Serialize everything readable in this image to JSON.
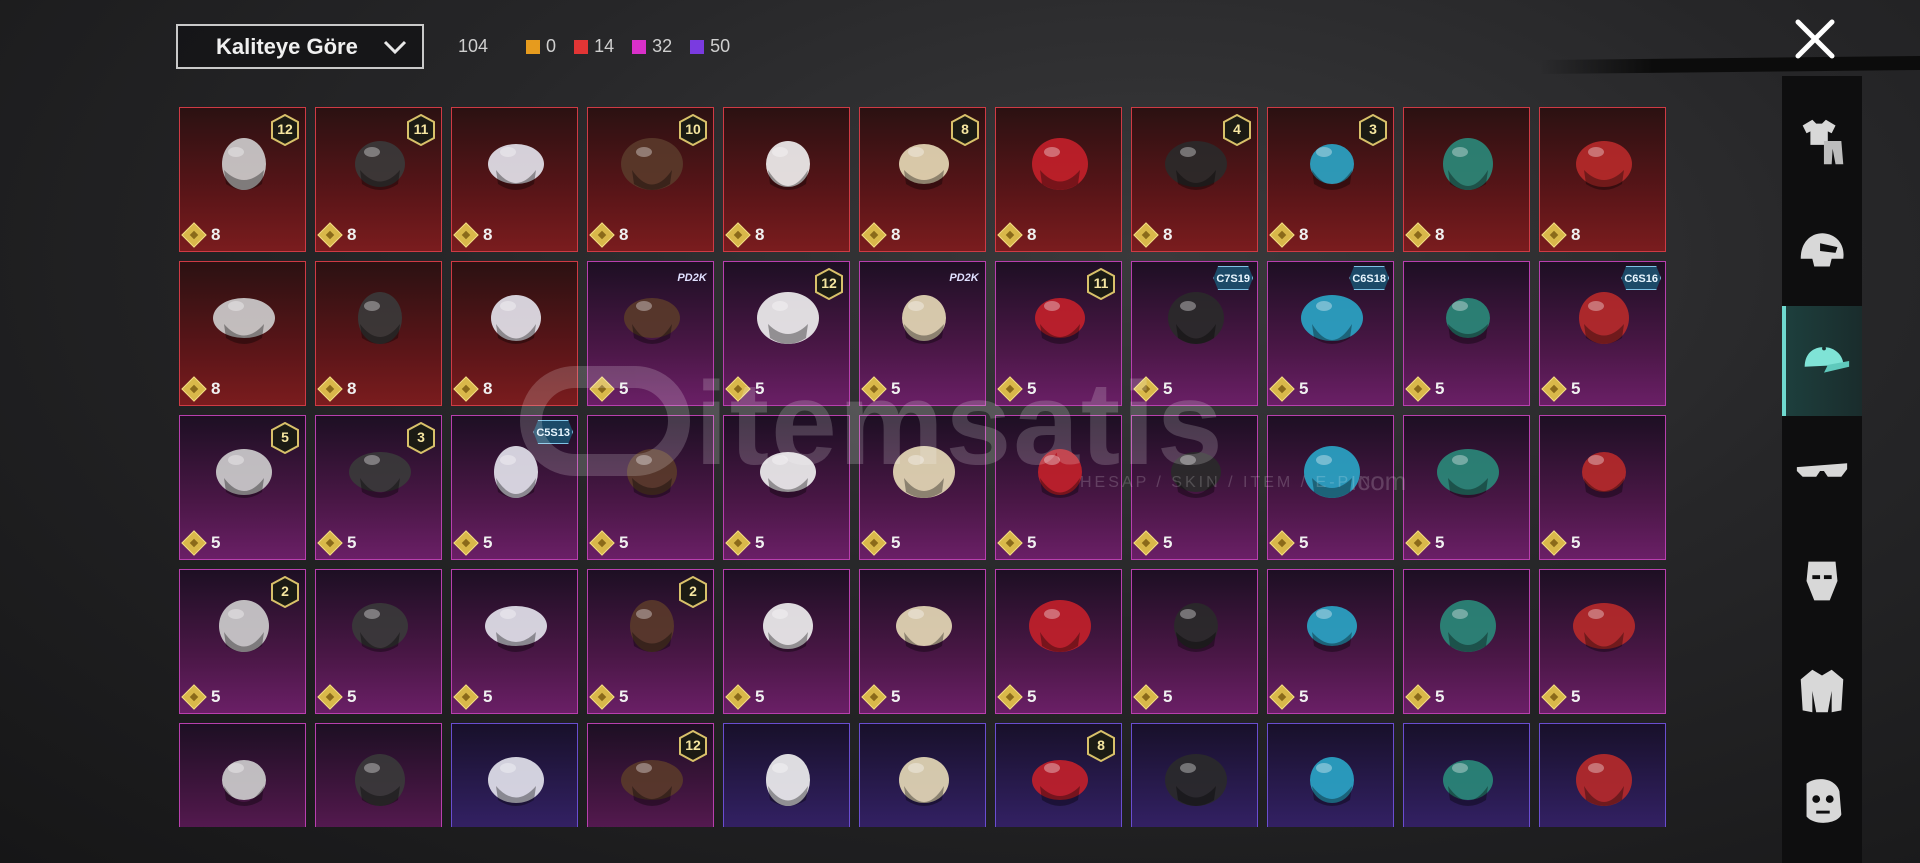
{
  "sort": {
    "label": "Kaliteye Göre"
  },
  "counts": {
    "total": "104",
    "tiers": [
      {
        "color": "#e69b1e",
        "value": "0"
      },
      {
        "color": "#e23535",
        "value": "14"
      },
      {
        "color": "#d930c9",
        "value": "32"
      },
      {
        "color": "#7a3be0",
        "value": "50"
      }
    ]
  },
  "watermark": {
    "brand": "itemsatis",
    "sub": "HESAP / SKIN / ITEM / E-PIN",
    "domain": ".com"
  },
  "sidebar": [
    {
      "name": "outfit-icon",
      "active": false
    },
    {
      "name": "helmet-icon",
      "active": false
    },
    {
      "name": "cap-icon",
      "active": true
    },
    {
      "name": "glasses-icon",
      "active": false
    },
    {
      "name": "mask-icon",
      "active": false
    },
    {
      "name": "jacket-icon",
      "active": false
    },
    {
      "name": "face-icon",
      "active": false
    }
  ],
  "items": [
    {
      "rarity": "red",
      "badge": "12",
      "tag": "",
      "value": "8",
      "icon": "silver-hair-bow-icon"
    },
    {
      "rarity": "red",
      "badge": "11",
      "tag": "",
      "value": "8",
      "icon": "black-ponytail-icon"
    },
    {
      "rarity": "red",
      "badge": "",
      "tag": "",
      "value": "8",
      "icon": "white-long-hair-icon"
    },
    {
      "rarity": "red",
      "badge": "10",
      "tag": "",
      "value": "8",
      "icon": "brown-braids-icon"
    },
    {
      "rarity": "red",
      "badge": "",
      "tag": "",
      "value": "8",
      "icon": "white-cowboy-hat-icon"
    },
    {
      "rarity": "red",
      "badge": "8",
      "tag": "",
      "value": "8",
      "icon": "blonde-elf-hair-icon"
    },
    {
      "rarity": "red",
      "badge": "",
      "tag": "",
      "value": "8",
      "icon": "red-helmet-icon"
    },
    {
      "rarity": "red",
      "badge": "4",
      "tag": "",
      "value": "8",
      "icon": "snowman-top-hat-icon"
    },
    {
      "rarity": "red",
      "badge": "3",
      "tag": "",
      "value": "8",
      "icon": "blue-curly-hair-icon"
    },
    {
      "rarity": "red",
      "badge": "",
      "tag": "",
      "value": "8",
      "icon": "dragon-helm-icon"
    },
    {
      "rarity": "red",
      "badge": "",
      "tag": "",
      "value": "8",
      "icon": "fox-mask-icon"
    },
    {
      "rarity": "red",
      "badge": "",
      "tag": "",
      "value": "8",
      "icon": "cyber-helmet-icon"
    },
    {
      "rarity": "red",
      "badge": "",
      "tag": "",
      "value": "8",
      "icon": "black-bunny-helmet-icon"
    },
    {
      "rarity": "red",
      "badge": "",
      "tag": "",
      "value": "8",
      "icon": "skull-helmet-icon"
    },
    {
      "rarity": "purple",
      "badge": "",
      "tag": "PD2K",
      "value": "5",
      "icon": "spiked-cap-icon"
    },
    {
      "rarity": "purple",
      "badge": "12",
      "tag": "",
      "value": "5",
      "icon": "orange-hair-icon"
    },
    {
      "rarity": "purple",
      "badge": "",
      "tag": "PD2K",
      "value": "5",
      "icon": "panda-head-icon"
    },
    {
      "rarity": "purple",
      "badge": "11",
      "tag": "",
      "value": "5",
      "icon": "flower-veil-icon"
    },
    {
      "rarity": "purple",
      "badge": "",
      "tag": "C7S19",
      "value": "5",
      "icon": "feather-headdress-icon"
    },
    {
      "rarity": "purple",
      "badge": "",
      "tag": "C6S18",
      "value": "5",
      "icon": "brown-hair-icon"
    },
    {
      "rarity": "purple",
      "badge": "",
      "tag": "",
      "value": "5",
      "icon": "red-bow-hair-icon"
    },
    {
      "rarity": "purple",
      "badge": "",
      "tag": "C6S16",
      "value": "5",
      "icon": "red-hood-icon"
    },
    {
      "rarity": "purple",
      "badge": "5",
      "tag": "",
      "value": "5",
      "icon": "pigtail-hair-icon"
    },
    {
      "rarity": "purple",
      "badge": "3",
      "tag": "",
      "value": "5",
      "icon": "jester-hat-icon"
    },
    {
      "rarity": "purple",
      "badge": "",
      "tag": "C5S13",
      "value": "5",
      "icon": "green-cat-hat-icon"
    },
    {
      "rarity": "purple",
      "badge": "",
      "tag": "",
      "value": "5",
      "icon": "potato-head-icon"
    },
    {
      "rarity": "purple",
      "badge": "",
      "tag": "",
      "value": "5",
      "icon": "white-bird-icon"
    },
    {
      "rarity": "purple",
      "badge": "",
      "tag": "",
      "value": "5",
      "icon": "duck-headphones-icon"
    },
    {
      "rarity": "purple",
      "badge": "",
      "tag": "",
      "value": "5",
      "icon": "straw-hat-icon"
    },
    {
      "rarity": "purple",
      "badge": "",
      "tag": "",
      "value": "5",
      "icon": "teal-creature-icon"
    },
    {
      "rarity": "purple",
      "badge": "",
      "tag": "",
      "value": "5",
      "icon": "grey-fedora-icon"
    },
    {
      "rarity": "purple",
      "badge": "",
      "tag": "",
      "value": "5",
      "icon": "purple-beast-icon"
    },
    {
      "rarity": "purple",
      "badge": "",
      "tag": "",
      "value": "5",
      "icon": "gas-mask-icon"
    },
    {
      "rarity": "purple",
      "badge": "2",
      "tag": "",
      "value": "5",
      "icon": "teal-knight-icon"
    },
    {
      "rarity": "purple",
      "badge": "",
      "tag": "",
      "value": "5",
      "icon": "box-head-icon"
    },
    {
      "rarity": "purple",
      "badge": "",
      "tag": "",
      "value": "5",
      "icon": "kendo-mask-icon"
    },
    {
      "rarity": "purple",
      "badge": "2",
      "tag": "",
      "value": "5",
      "icon": "predator-mask-icon"
    },
    {
      "rarity": "purple",
      "badge": "",
      "tag": "",
      "value": "5",
      "icon": "tribal-mask-icon"
    },
    {
      "rarity": "purple",
      "badge": "",
      "tag": "",
      "value": "5",
      "icon": "white-lion-icon"
    },
    {
      "rarity": "purple",
      "badge": "",
      "tag": "",
      "value": "5",
      "icon": "goggle-helmet-icon"
    },
    {
      "rarity": "purple",
      "badge": "",
      "tag": "",
      "value": "5",
      "icon": "frog-cap-icon"
    },
    {
      "rarity": "purple",
      "badge": "",
      "tag": "",
      "value": "5",
      "icon": "frog-officer-icon"
    },
    {
      "rarity": "purple",
      "badge": "",
      "tag": "",
      "value": "5",
      "icon": "red-hair-cap-icon"
    },
    {
      "rarity": "purple",
      "badge": "",
      "tag": "",
      "value": "5",
      "icon": "white-monkey-icon"
    },
    {
      "rarity": "purple",
      "badge": "",
      "tag": "",
      "value": "",
      "icon": "black-ears-icon"
    },
    {
      "rarity": "purple",
      "badge": "",
      "tag": "",
      "value": "",
      "icon": "white-bucket-hat-icon"
    },
    {
      "rarity": "violet",
      "badge": "",
      "tag": "",
      "value": "",
      "icon": "grey-dreads-icon"
    },
    {
      "rarity": "purple",
      "badge": "12",
      "tag": "",
      "value": "",
      "icon": "bunny-ears-icon"
    },
    {
      "rarity": "violet",
      "badge": "",
      "tag": "",
      "value": "",
      "icon": "horns-headband-icon"
    },
    {
      "rarity": "violet",
      "badge": "",
      "tag": "",
      "value": "",
      "icon": "officer-caps-icon"
    },
    {
      "rarity": "violet",
      "badge": "8",
      "tag": "",
      "value": "",
      "icon": "green-skull-hood-icon"
    },
    {
      "rarity": "violet",
      "badge": "",
      "tag": "",
      "value": "",
      "icon": "baseball-cap-icon"
    },
    {
      "rarity": "violet",
      "badge": "",
      "tag": "",
      "value": "",
      "icon": "gas-mask-helmet-icon"
    },
    {
      "rarity": "violet",
      "badge": "",
      "tag": "",
      "value": "",
      "icon": "visor-helmet-icon"
    },
    {
      "rarity": "violet",
      "badge": "",
      "tag": "",
      "value": "",
      "icon": "red-hair-goggles-icon"
    }
  ]
}
